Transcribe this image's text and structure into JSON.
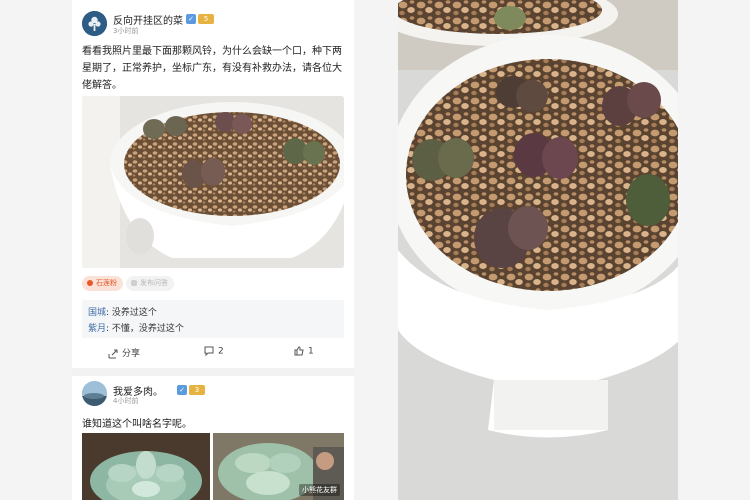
{
  "post1": {
    "username": "反向开挂区的菜",
    "badge_level": "5",
    "time": "3小时前",
    "body": "看看我照片里最下面那颗风铃，为什么会缺一个口，种下两星期了，正常养护，坐标广东，有没有补救办法，请各位大佬解答。",
    "tags": {
      "hot": "石莲粉",
      "other": "发布问答"
    },
    "comments": [
      {
        "author": "国城",
        "text": ": 没养过这个"
      },
      {
        "author": "紫月",
        "text": ": 不懂，没养过这个"
      }
    ],
    "actions": {
      "share": "分享",
      "comment_count": "2",
      "like_count": "1"
    }
  },
  "post2": {
    "username": "我爱多肉。",
    "badge_level": "3",
    "time": "4小时前",
    "body": "谁知道这个叫啥名字呢。",
    "watermark": "小熊花友群"
  },
  "colors": {
    "accent": "#3f6ea8",
    "hot_tag": "#e35b2b",
    "badge_blue": "#5a9be0",
    "badge_gold": "#e7b340"
  }
}
